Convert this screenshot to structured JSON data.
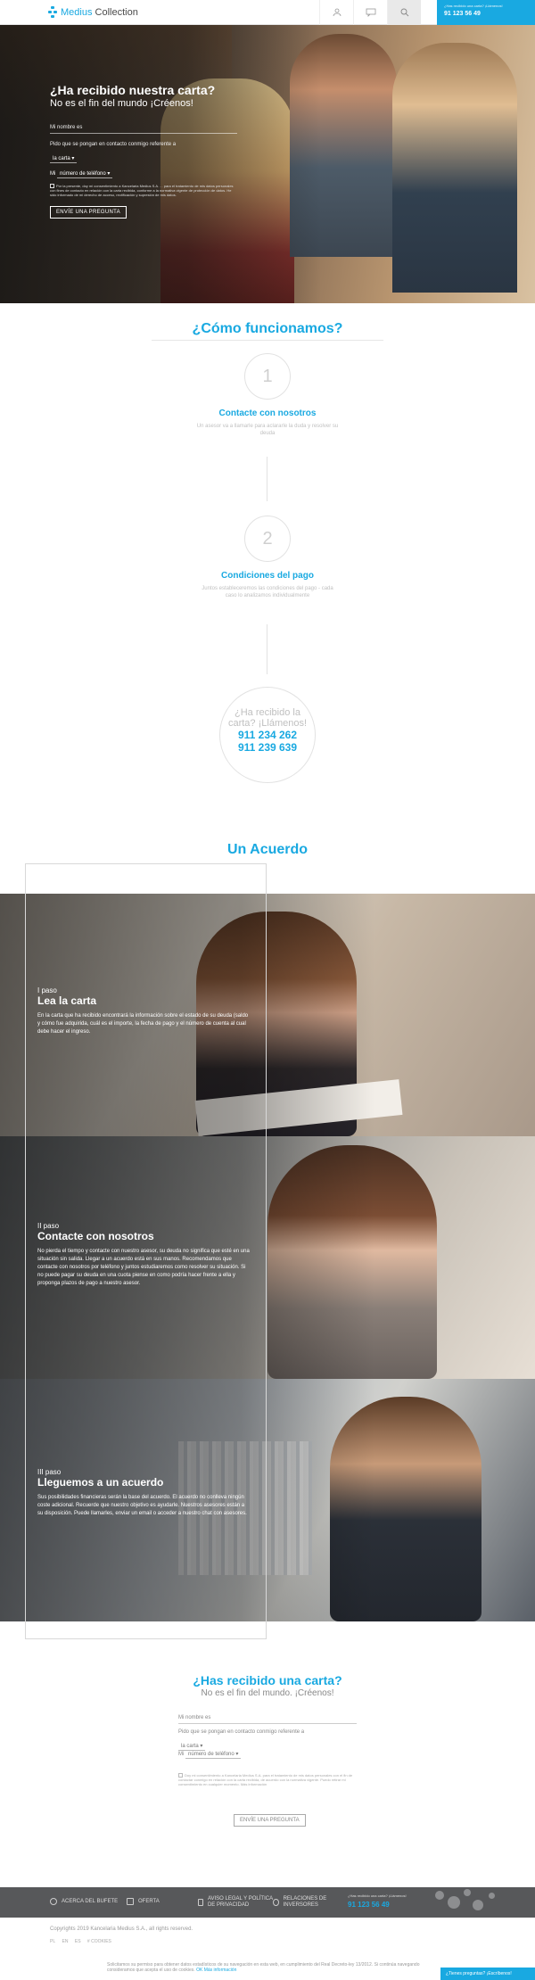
{
  "header": {
    "logo_word1": "Medius",
    "logo_word2": "Collection",
    "cta_small": "¿Has recibido una carta? ¡Llámenos!",
    "cta_phone": "91 123 56 49"
  },
  "hero": {
    "title": "¿Ha recibido nuestra carta?",
    "subtitle": "No es el fin del mundo ¡Créenos!",
    "name_placeholder": "Mi nombre es",
    "contact_text": "Pido que se pongan en contacto conmigo referente a",
    "contact_select": "la carta",
    "phone_label": "Mi",
    "phone_select": "número de teléfono",
    "legal": "Por la presente, doy mi consentimiento a Kancelaria Medius S.A. ... para el tratamiento de mis datos personales con fines de contacto en relación con la carta recibida, conforme a la normativa vigente de protección de datos. He sido informado de mi derecho de acceso, rectificación y supresión de mis datos.",
    "button": "ENVÍE UNA PREGUNTA"
  },
  "how": {
    "title": "¿Cómo funcionamos?",
    "steps": [
      {
        "num": "1",
        "title": "Contacte con nosotros",
        "desc": "Un asesor va a llamarle para aclararle la duda y resolver su deuda"
      },
      {
        "num": "2",
        "title": "Condiciones del pago",
        "desc": "Juntos estableceremos las condiciones del pago - cada caso lo analizamos individualmente"
      }
    ],
    "call_question": "¿Ha recibido la carta? ¡Llámenos!",
    "phone1": "911 234 262",
    "phone2": "911 239 639"
  },
  "agreement": {
    "title": "Un Acuerdo",
    "steps": [
      {
        "kicker": "I paso",
        "title": "Lea la carta",
        "text": "En la carta que ha recibido encontrará la información sobre el estado de su deuda (saldo y cómo fue adquirida, cuál es el importe, la fecha de pago y el número de cuenta al cual debe hacer el ingreso."
      },
      {
        "kicker": "II paso",
        "title": "Contacte con nosotros",
        "text": "No pierda el tiempo y contacte con nuestro asesor, su deuda no significa que esté en una situación sin salida. Llegar a un acuerdo está en sus manos. Recomendamos que contacte con nosotros por teléfono y juntos estudiaremos como resolver su situación. Si no puede pagar su deuda en una cuota piense en como podría hacer frente a ella y proponga plazos de pago a nuestro asesor."
      },
      {
        "kicker": "III paso",
        "title": "Lleguemos a un acuerdo",
        "text": "Sus posibilidades financieras serán la base del acuerdo. El acuerdo no conlleva ningún coste adicional. Recuerde que nuestro objetivo es ayudarle. Nuestros asesores están a su disposición. Puede llamarles, enviar un email o acceder a nuestro chat con asesores."
      }
    ]
  },
  "form2": {
    "title": "¿Has recibido una carta?",
    "subtitle": "No es el fin del mundo. ¡Créenos!",
    "name_placeholder": "Mi nombre es",
    "contact_text": "Pido que se pongan en contacto conmigo referente a",
    "contact_select": "la carta",
    "phone_label": "Mi",
    "phone_select": "número de teléfono",
    "legal": "Doy mi consentimiento a Kancelaria Medius S.A. para el tratamiento de mis datos personales con el fin de contactar conmigo en relación con la carta recibida, de acuerdo con la normativa vigente. Puedo retirar mi consentimiento en cualquier momento. Más información",
    "button": "ENVÍE UNA PREGUNTA"
  },
  "footer": {
    "items": [
      "ACERCA DEL BUFETE",
      "OFERTA",
      "AVISO LEGAL Y POLÍTICA DE PRIVACIDAD",
      "RELACIONES DE INVERSORES"
    ],
    "call_small": "¿Has recibido una carta? ¡Llámenos!",
    "call_phone": "91 123 56 49",
    "copyright": "Copyrights 2019 Kancelaria Medius S.A., all rights reserved.",
    "langs": [
      "PL",
      "EN",
      "ES",
      "# COOKIES"
    ],
    "cookie_text": "Solicitamos su permiso para obtener datos estadísticos de su navegación en esta web, en cumplimiento del Real Decreto-ley 13/2012. Si continúa navegando consideramos que acepta el uso de cookies.",
    "cookie_link1": "OK",
    "cookie_link2": "Más información",
    "chat": "¿Tienes preguntas? ¡Escríbenos!"
  },
  "colors": {
    "accent": "#19a9e1",
    "footer_bg": "#57585a"
  }
}
